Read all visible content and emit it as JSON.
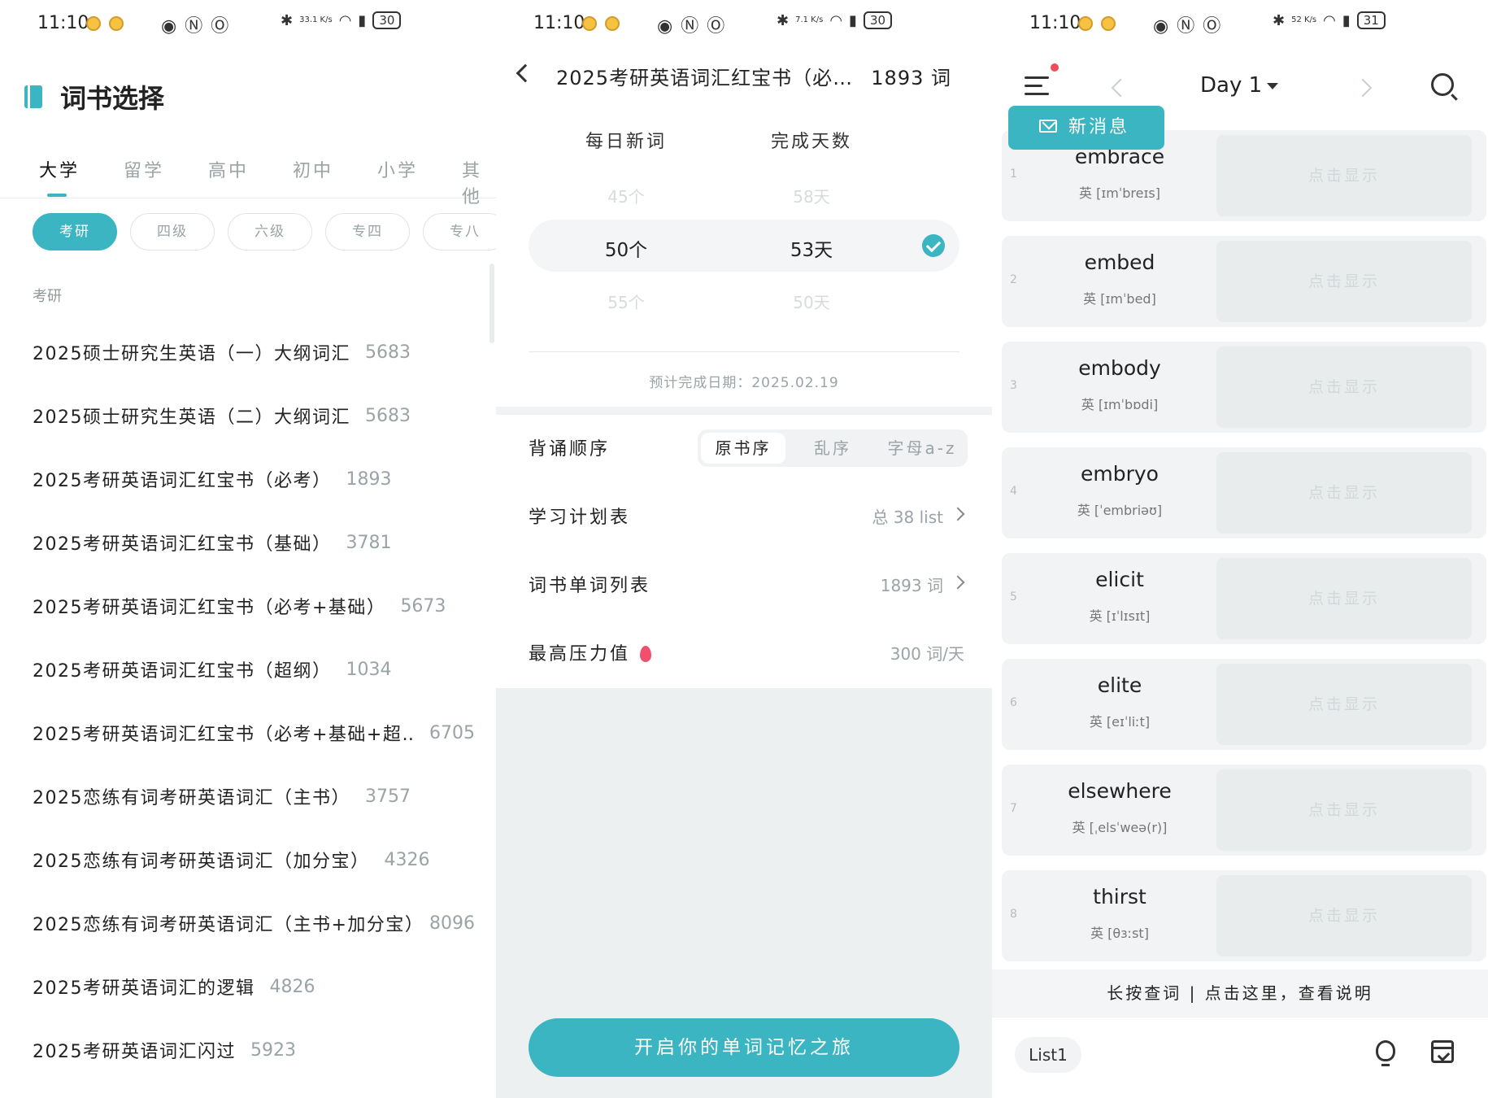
{
  "screens": [
    {
      "status": {
        "time": "11:10",
        "speed": "33.1 K/s",
        "battery": "30"
      },
      "title": "词书选择",
      "tabs": [
        "大学",
        "留学",
        "高中",
        "初中",
        "小学",
        "其他"
      ],
      "chips": [
        "考研",
        "四级",
        "六级",
        "专四",
        "专八"
      ],
      "section": "考研",
      "books": [
        {
          "name": "2025硕士研究生英语（一）大纲词汇",
          "count": "5683"
        },
        {
          "name": "2025硕士研究生英语（二）大纲词汇",
          "count": "5683"
        },
        {
          "name": "2025考研英语词汇红宝书（必考）",
          "count": "1893"
        },
        {
          "name": "2025考研英语词汇红宝书（基础）",
          "count": "3781"
        },
        {
          "name": "2025考研英语词汇红宝书（必考+基础）",
          "count": "5673"
        },
        {
          "name": "2025考研英语词汇红宝书（超纲）",
          "count": "1034"
        },
        {
          "name": "2025考研英语词汇红宝书（必考+基础+超…",
          "count": "6705"
        },
        {
          "name": "2025恋练有词考研英语词汇（主书）",
          "count": "3757"
        },
        {
          "name": "2025恋练有词考研英语词汇（加分宝）",
          "count": "4326"
        },
        {
          "name": "2025恋练有词考研英语词汇（主书+加分宝）",
          "count": "8096"
        },
        {
          "name": "2025考研英语词汇的逻辑",
          "count": "4826"
        },
        {
          "name": "2025考研英语词汇闪过",
          "count": "5923"
        }
      ]
    },
    {
      "status": {
        "time": "11:10",
        "speed": "7.1 K/s",
        "battery": "30"
      },
      "title": "2025考研英语词汇红宝书（必…",
      "word_count": "1893 词",
      "col_daily": "每日新词",
      "col_days": "完成天数",
      "picker_prev": {
        "daily": "45个",
        "days": "58天"
      },
      "picker_selected": {
        "daily": "50个",
        "days": "53天"
      },
      "picker_next": {
        "daily": "55个",
        "days": "50天"
      },
      "eta": "预计完成日期：2025.02.19",
      "order_label": "背诵顺序",
      "order_options": [
        "原书序",
        "乱序",
        "字母a-z"
      ],
      "plan_label": "学习计划表",
      "plan_value": "总 38 list",
      "wordlist_label": "词书单词列表",
      "wordlist_value": "1893 词",
      "pressure_label": "最高压力值",
      "pressure_value": "300 词/天",
      "start_button": "开启你的单词记忆之旅"
    },
    {
      "status": {
        "time": "11:10",
        "speed": "52 K/s",
        "battery": "31"
      },
      "day": "Day 1",
      "message_button": "新消息",
      "reveal_label": "点击显示",
      "words": [
        {
          "index": "1",
          "word": "embrace",
          "phonetic": "英 [ɪmˈbreɪs]"
        },
        {
          "index": "2",
          "word": "embed",
          "phonetic": "英 [ɪmˈbed]"
        },
        {
          "index": "3",
          "word": "embody",
          "phonetic": "英 [ɪmˈbɒdi]"
        },
        {
          "index": "4",
          "word": "embryo",
          "phonetic": "英 [ˈembriəʊ]"
        },
        {
          "index": "5",
          "word": "elicit",
          "phonetic": "英 [ɪˈlɪsɪt]"
        },
        {
          "index": "6",
          "word": "elite",
          "phonetic": "英 [eɪˈliːt]"
        },
        {
          "index": "7",
          "word": "elsewhere",
          "phonetic": "英 [ˌelsˈweə(r)]"
        },
        {
          "index": "8",
          "word": "thirst",
          "phonetic": "英 [θɜːst]"
        }
      ],
      "hint": "长按查词 | 点击这里，查看说明",
      "list_chip": "List1"
    }
  ],
  "colors": {
    "accent": "#3bb5c1",
    "badge": "#f24c58",
    "flame": "#f0506e"
  },
  "icons": [
    "book-icon",
    "back-icon",
    "check-icon",
    "chevron-right-icon",
    "flame-icon",
    "menu-icon",
    "search-icon",
    "mail-icon",
    "bulb-icon",
    "calendar-icon"
  ]
}
